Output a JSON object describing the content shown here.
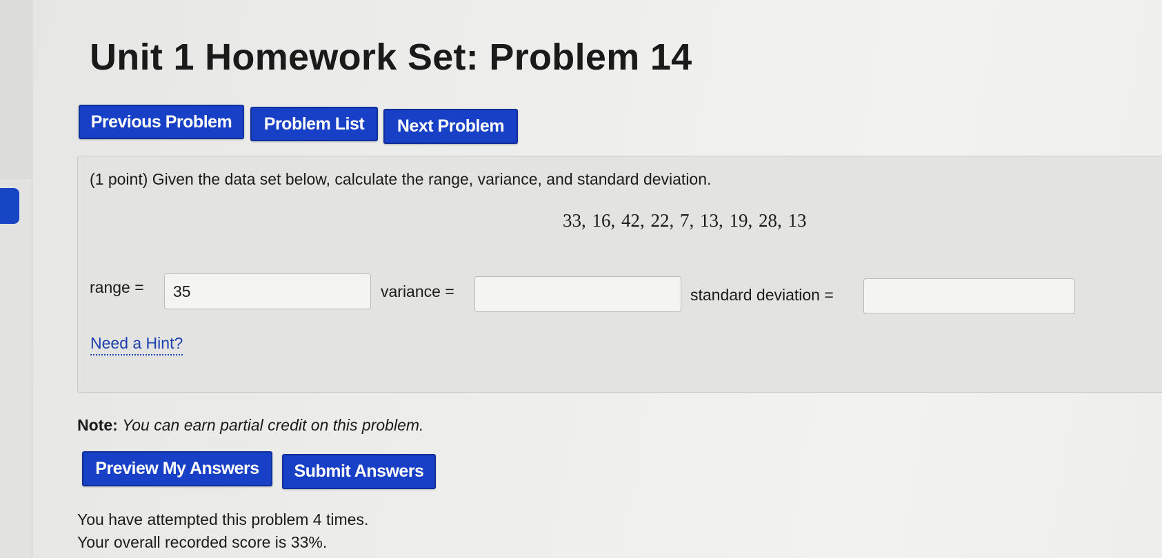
{
  "page": {
    "title": "Unit 1 Homework Set: Problem 14"
  },
  "nav": {
    "previous_label": "Previous Problem",
    "list_label": "Problem List",
    "next_label": "Next Problem"
  },
  "problem": {
    "prompt": "(1 point) Given the data set below, calculate the range, variance, and standard deviation.",
    "data_set": "33, 16, 42, 22, 7, 13, 19, 28, 13",
    "fields": [
      {
        "label": "range =",
        "value": "35"
      },
      {
        "label": "variance =",
        "value": ""
      },
      {
        "label": "standard deviation =",
        "value": ""
      }
    ],
    "hint_label": "Need a Hint?"
  },
  "note": {
    "label": "Note:",
    "text": "You can earn partial credit on this problem."
  },
  "actions": {
    "preview_label": "Preview My Answers",
    "submit_label": "Submit Answers"
  },
  "status": {
    "attempts": "You have attempted this problem 4 times.",
    "score": "Your overall recorded score is 33%."
  },
  "colors": {
    "button_blue": "#1740c6",
    "link_blue": "#1d3fae"
  }
}
